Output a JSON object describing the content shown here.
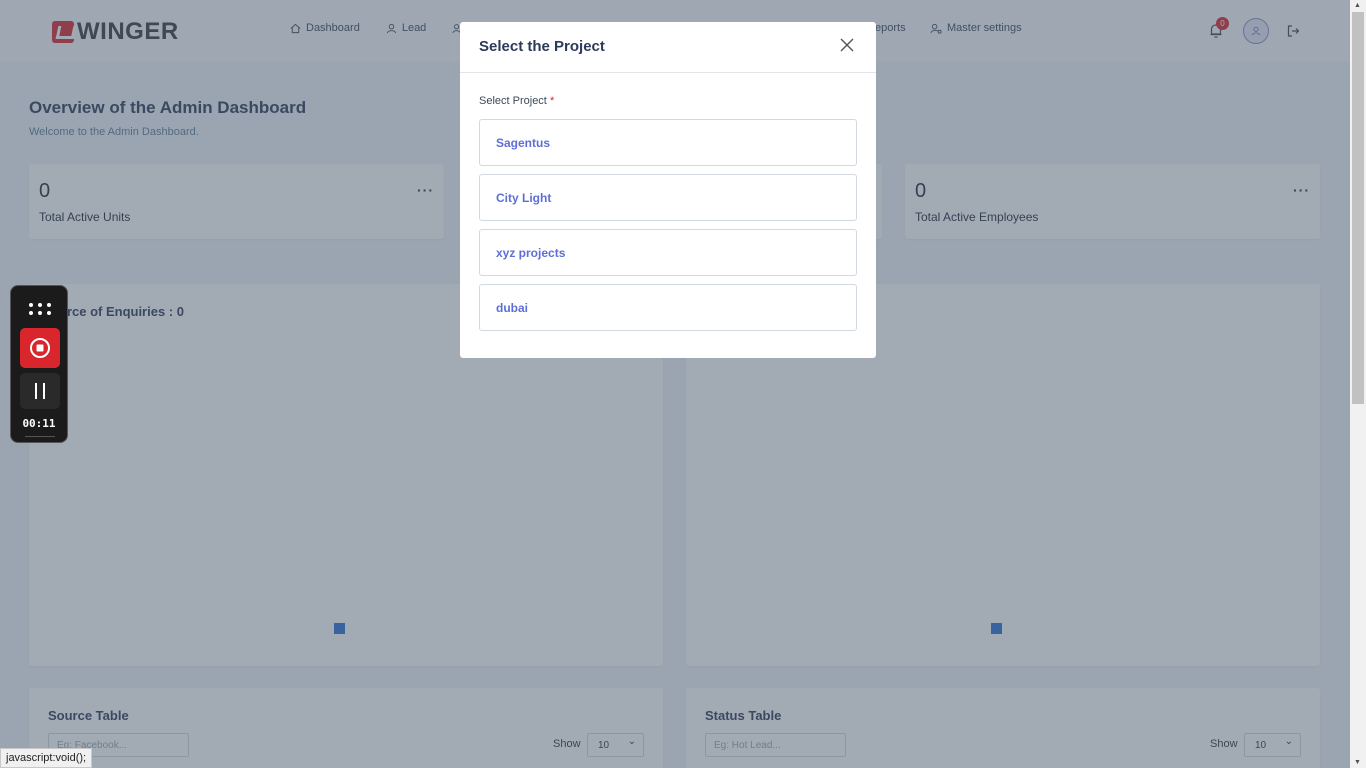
{
  "brand": {
    "name": "WINGER",
    "accent": "#d9262c"
  },
  "nav": {
    "items": [
      {
        "label": "Dashboard",
        "icon": "home-icon"
      },
      {
        "label": "Lead",
        "icon": "user-icon"
      }
    ],
    "right_items": [
      {
        "label": "eports",
        "icon": "chart-icon"
      },
      {
        "label": "Master settings",
        "icon": "settings-user-icon"
      }
    ],
    "notification_count": "0"
  },
  "header": {
    "title": "Overview of the Admin Dashboard",
    "subtitle": "Welcome to the Admin Dashboard."
  },
  "stats": [
    {
      "value": "0",
      "label": "Total Active Units",
      "menu": "···"
    },
    {
      "value": "0",
      "label": "Total Active Employees",
      "menu": "···"
    }
  ],
  "charts": {
    "source_title": "urce of Enquiries : 0"
  },
  "tables": {
    "source": {
      "title": "Source Table",
      "placeholder": "Eg: Facebook...",
      "show_label": "Show",
      "show_value": "10"
    },
    "status": {
      "title": "Status Table",
      "placeholder": "Eg: Hot Lead...",
      "show_label": "Show",
      "show_value": "10"
    }
  },
  "modal": {
    "title": "Select the Project",
    "field_label": "Select Project",
    "required_mark": "*",
    "projects": [
      "Sagentus",
      "City Light",
      "xyz projects",
      "dubai"
    ]
  },
  "recorder": {
    "time": "00:11"
  },
  "statusbar": {
    "text": "javascript:void();"
  }
}
